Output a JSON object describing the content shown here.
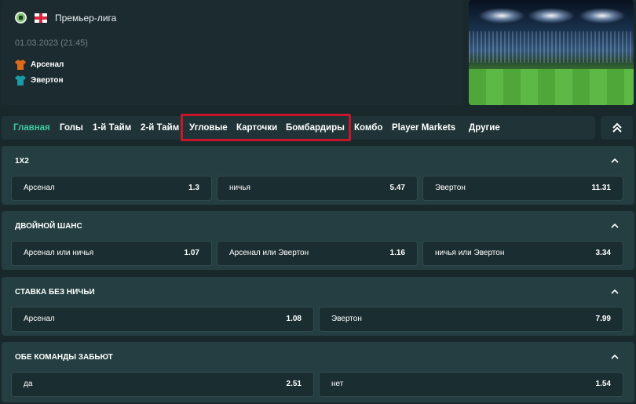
{
  "match": {
    "league": "Премьер-лига",
    "date": "01.03.2023 (21:45)",
    "home_team": "Арсенал",
    "away_team": "Эвертон",
    "home_color": "#e06a1c",
    "away_color": "#1a9aa6"
  },
  "tabs": [
    {
      "label": "Главная",
      "active": true
    },
    {
      "label": "Голы"
    },
    {
      "label": "1-й Тайм"
    },
    {
      "label": "2-й Тайм"
    },
    {
      "label": "Угловые"
    },
    {
      "label": "Карточки"
    },
    {
      "label": "Бомбардиры"
    },
    {
      "label": "Комбо"
    },
    {
      "label": "Player Markets"
    },
    {
      "label": "Другие"
    }
  ],
  "markets": [
    {
      "title": "1X2",
      "odds": [
        {
          "label": "Арсенал",
          "value": "1.3"
        },
        {
          "label": "ничья",
          "value": "5.47"
        },
        {
          "label": "Эвертон",
          "value": "11.31"
        }
      ]
    },
    {
      "title": "ДВОЙНОЙ ШАНС",
      "odds": [
        {
          "label": "Арсенал или ничья",
          "value": "1.07"
        },
        {
          "label": "Арсенал или Эвертон",
          "value": "1.16"
        },
        {
          "label": "ничья или Эвертон",
          "value": "3.34"
        }
      ]
    },
    {
      "title": "СТАВКА БЕЗ НИЧЬИ",
      "odds": [
        {
          "label": "Арсенал",
          "value": "1.08"
        },
        {
          "label": "Эвертон",
          "value": "7.99"
        }
      ]
    },
    {
      "title": "ОБЕ КОМАНДЫ ЗАБЬЮТ",
      "odds": [
        {
          "label": "да",
          "value": "2.51"
        },
        {
          "label": "нет",
          "value": "1.54"
        }
      ]
    }
  ],
  "colors": {
    "accent": "#3ec9a0",
    "highlight_border": "#c8152a"
  },
  "icons": [
    "soccer-ball-icon",
    "england-flag-icon",
    "shirt-icon",
    "chevron-up-icon",
    "double-chevron-up-icon"
  ]
}
